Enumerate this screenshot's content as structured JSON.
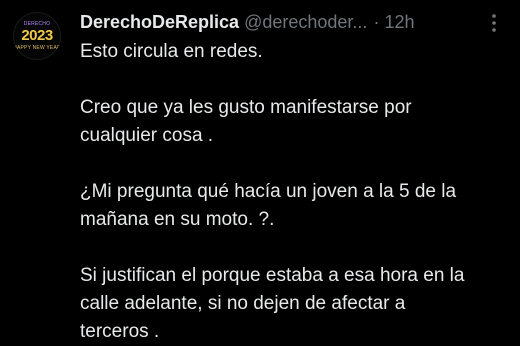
{
  "avatar": {
    "top_text": "DERECHO",
    "year": "2023",
    "sub_text": "HAPPY NEW YEAR"
  },
  "header": {
    "display_name": "DerechoDeReplica",
    "handle": "@derechoder...",
    "separator": "·",
    "time": "12h"
  },
  "icons": {
    "more": "more-vertical-icon"
  },
  "tweet": {
    "paragraphs": [
      "Esto circula en redes.",
      "Creo que ya les gusto manifestarse por\ncualquier cosa .",
      "¿Mi pregunta qué hacía un joven a la 5 de la\nmañana en su moto. ?.",
      "Si justifican el porque estaba a esa hora en la\ncalle adelante, si no dejen de afectar a\nterceros ."
    ]
  },
  "colors": {
    "background": "#000000",
    "text": "#e7e9ea",
    "muted": "#71767b"
  }
}
